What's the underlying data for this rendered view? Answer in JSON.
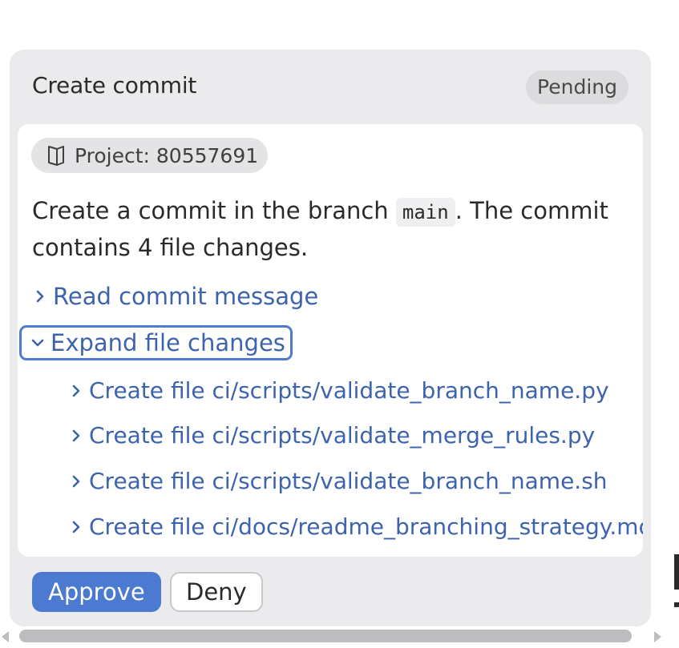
{
  "card": {
    "title": "Create commit",
    "status": "Pending"
  },
  "project": {
    "label": "Project: 80557691",
    "icon": "book-icon"
  },
  "description": {
    "before": "Create a commit in the branch ",
    "branch": "main",
    "after": ". The commit contains 4 file changes."
  },
  "links": {
    "read_message": "Read commit message",
    "expand_changes": "Expand file changes"
  },
  "files": [
    "Create file ci/scripts/validate_branch_name.py",
    "Create file ci/scripts/validate_merge_rules.py",
    "Create file ci/scripts/validate_branch_name.sh",
    "Create file ci/docs/readme_branching_strategy.md"
  ],
  "actions": {
    "approve": "Approve",
    "deny": "Deny"
  },
  "colors": {
    "accent": "#4b7ad0",
    "link": "#3e63ad",
    "card_bg": "#ebebed"
  }
}
